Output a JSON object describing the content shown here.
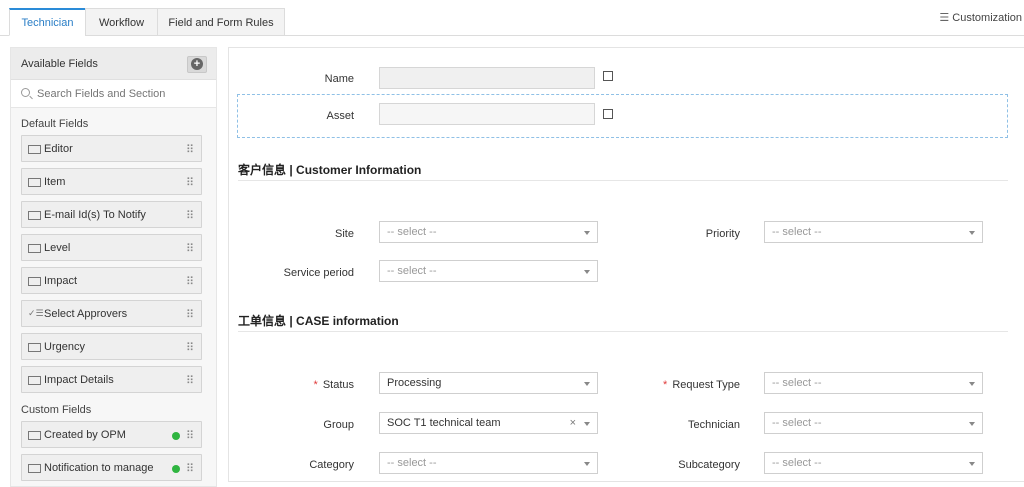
{
  "tabs": [
    "Technician",
    "Workflow",
    "Field and Form Rules"
  ],
  "customization_label": "Customization",
  "left_panel": {
    "title": "Available Fields",
    "search_placeholder": "Search Fields and Section",
    "default_section": "Default Fields",
    "default_fields": [
      "Editor",
      "Item",
      "E-mail Id(s) To Notify",
      "Level",
      "Impact",
      "Select Approvers",
      "Urgency",
      "Impact Details"
    ],
    "custom_section": "Custom Fields",
    "custom_fields": [
      "Created by OPM",
      "Notification to manage"
    ]
  },
  "form": {
    "name_label": "Name",
    "asset_label": "Asset",
    "section1_title": "客户信息 | Customer Information",
    "site_label": "Site",
    "site_value": "-- select --",
    "priority_label": "Priority",
    "priority_value": "-- select --",
    "service_period_label": "Service period",
    "service_period_value": "-- select --",
    "section2_title": "工单信息 | CASE information",
    "status_label": "Status",
    "status_value": "Processing",
    "request_type_label": "Request Type",
    "request_type_value": "-- select --",
    "group_label": "Group",
    "group_value": "SOC T1 technical team",
    "technician_label": "Technician",
    "technician_value": "-- select --",
    "category_label": "Category",
    "category_value": "-- select --",
    "subcategory_label": "Subcategory",
    "subcategory_value": "-- select --",
    "clear_glyph": "×",
    "required_glyph": "*"
  }
}
